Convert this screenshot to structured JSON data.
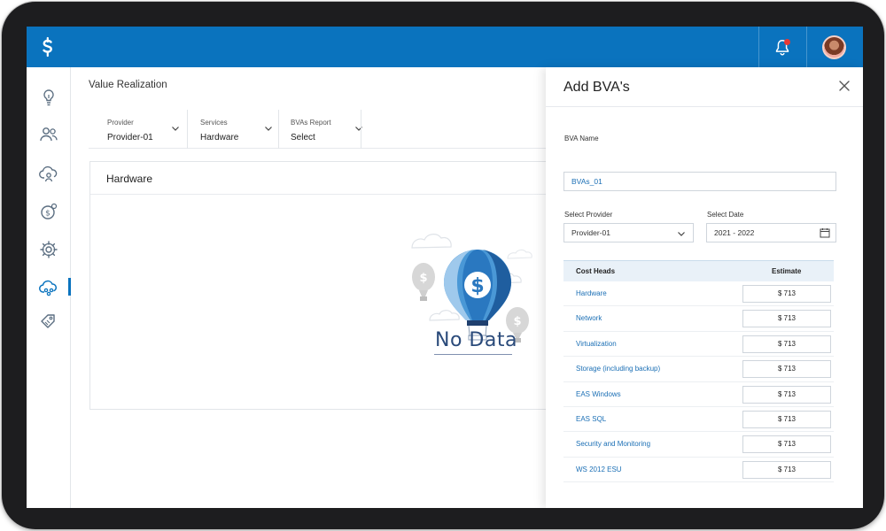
{
  "header": {
    "logo_icon": "dollar-logo-icon",
    "notification_icon": "bell-icon",
    "accent_color": "#0a73be"
  },
  "sidebar": {
    "items": [
      {
        "icon": "lightbulb-icon"
      },
      {
        "icon": "users-icon"
      },
      {
        "icon": "cloud-user-icon"
      },
      {
        "icon": "dollar-cycle-icon"
      },
      {
        "icon": "gear-cog-icon"
      },
      {
        "icon": "cloud-network-icon",
        "active": true
      },
      {
        "icon": "tag-icon"
      }
    ]
  },
  "page": {
    "title": "Value Realization",
    "filters": [
      {
        "label": "Provider",
        "value": "Provider-01"
      },
      {
        "label": "Services",
        "value": "Hardware"
      },
      {
        "label": "BVAs Report",
        "value": "Select"
      }
    ],
    "card_title": "Hardware",
    "no_data_text": "No Data"
  },
  "drawer": {
    "title": "Add BVA's",
    "bva_name_label": "BVA Name",
    "bva_name_value": "BVAs_01",
    "provider_label": "Select Provider",
    "provider_value": "Provider-01",
    "date_label": "Select Date",
    "date_value": "2021 - 2022",
    "table": {
      "headers": {
        "cost_heads": "Cost Heads",
        "estimate": "Estimate"
      },
      "rows": [
        {
          "name": "Hardware",
          "estimate": "$ 713"
        },
        {
          "name": "Network",
          "estimate": "$ 713"
        },
        {
          "name": "Virtualization",
          "estimate": "$ 713"
        },
        {
          "name": "Storage (including backup)",
          "estimate": "$ 713"
        },
        {
          "name": "EAS Windows",
          "estimate": "$ 713"
        },
        {
          "name": "EAS SQL",
          "estimate": "$ 713"
        },
        {
          "name": "Security and Monitoring",
          "estimate": "$ 713"
        },
        {
          "name": "WS 2012 ESU",
          "estimate": "$ 713"
        }
      ]
    }
  }
}
